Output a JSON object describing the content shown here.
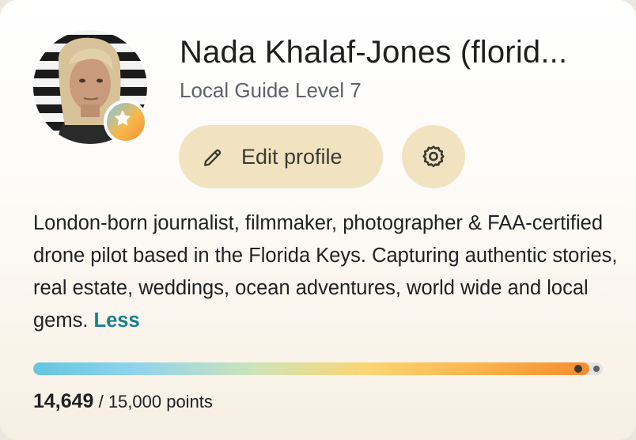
{
  "profile": {
    "name": "Nada Khalaf-Jones (florid...",
    "level": "Local Guide Level 7",
    "bio": "London-born journalist, filmmaker, photographer & FAA-certified drone pilot based in the Florida Keys. Capturing authentic stories, real estate, weddings, ocean adventures, world wide and local gems.",
    "bio_toggle": "Less"
  },
  "actions": {
    "edit_label": "Edit profile",
    "edit_icon": "pencil-icon",
    "settings_icon": "gear-icon"
  },
  "progress": {
    "current": "14,649",
    "separator": " / ",
    "target": "15,000 points",
    "fraction": 0.9766
  },
  "colors": {
    "button_bg": "#f1e3c0",
    "link": "#1a7f8e",
    "progress_start": "#63c6dd",
    "progress_end": "#f58c2f"
  },
  "icons": {
    "badge": "star-badge-icon"
  }
}
